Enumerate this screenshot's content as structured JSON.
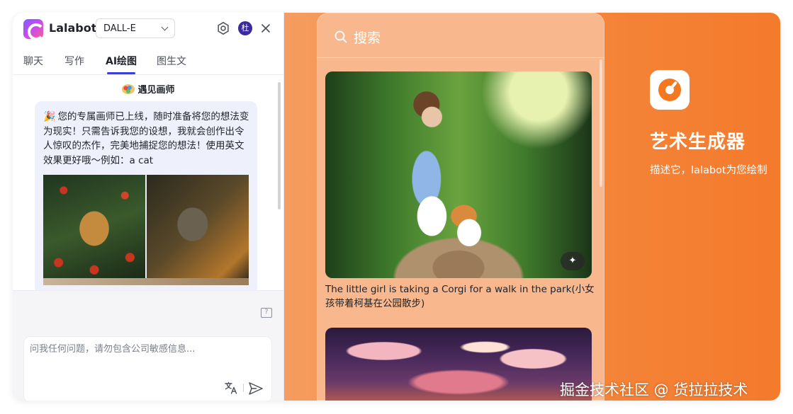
{
  "header": {
    "app_name": "Lalabot",
    "model_selected": "DALL-E",
    "avatar_initial": "杜"
  },
  "tabs": [
    "聊天",
    "写作",
    "AI绘图",
    "图生文"
  ],
  "active_tab": "AI绘图",
  "chat": {
    "bot_name": "遇见画师",
    "message": "您的专属画师已上线，随时准备将您的想法变为现实！只需告诉我您的设想，我就会创作出令人惊叹的杰作，完美地捕捉您的想法！使用英文效果更好哦～例如：a cat",
    "input_placeholder": "问我任何问题，请勿包含公司敏感信息..."
  },
  "gallery": {
    "search_label": "搜索",
    "items": [
      {
        "caption": "The little girl is taking a Corgi for a walk in the park(小女孩带着柯基在公园散步)"
      }
    ]
  },
  "hero": {
    "title": "艺术生成器",
    "subtitle": "描述它，lalabot为您绘制"
  },
  "watermark": "掘金技术社区 @ 货拉拉技术",
  "colors": {
    "accent": "#3b3fd9",
    "brand_orange": "#f4781f",
    "bubble_bg": "#eef0fb"
  },
  "icons": [
    "settings-icon",
    "close-icon",
    "chevron-down-icon",
    "feedback-icon",
    "translate-icon",
    "send-icon",
    "search-icon",
    "enhance-icon",
    "palette-icon",
    "party-icon"
  ]
}
